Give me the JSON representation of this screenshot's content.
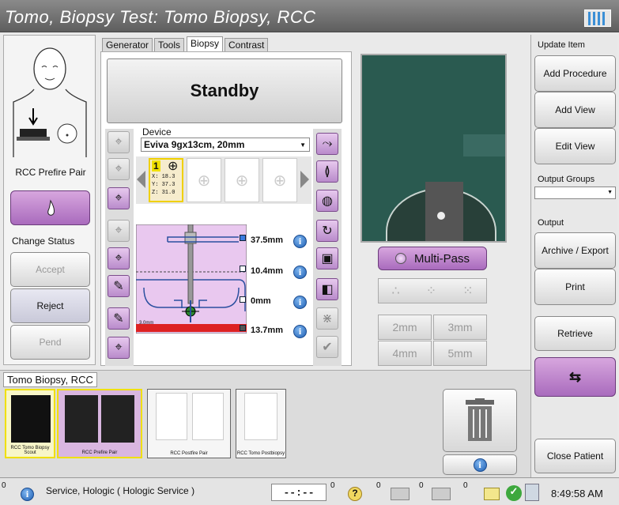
{
  "title": "Tomo, Biopsy Test:  Tomo Biopsy, RCC",
  "tabs": [
    "Generator",
    "Tools",
    "Biopsy",
    "Contrast"
  ],
  "left_panel": {
    "view_label": "RCC Prefire Pair",
    "change_status_label": "Change Status",
    "accept": "Accept",
    "reject": "Reject",
    "pend": "Pend"
  },
  "center": {
    "status": "Standby",
    "device_label": "Device",
    "device_value": "Eviva 9gx13cm, 20mm",
    "target": {
      "index": "1",
      "x": "X: 18.3",
      "y": "Y: 37.3",
      "z": "Z: 31.0"
    },
    "values": [
      "37.5mm",
      "10.4mm",
      "0mm",
      "13.7mm"
    ],
    "diagram_label": "3.0mm",
    "multipass": "Multi-Pass",
    "mm_buttons": [
      "2mm",
      "3mm",
      "4mm",
      "5mm"
    ]
  },
  "right_panel": {
    "update_item": "Update Item",
    "add_procedure": "Add Procedure",
    "add_view": "Add View",
    "edit_view": "Edit View",
    "output_groups": "Output Groups",
    "output": "Output",
    "archive_export": "Archive / Export",
    "print": "Print",
    "retrieve": "Retrieve",
    "close_patient": "Close Patient"
  },
  "procedure": {
    "name": "Tomo Biopsy, RCC",
    "thumbnails": [
      "RCC Tomo Biopsy Scout",
      "RCC Prefire Pair",
      "RCC Postfire Pair",
      "RCC Tomo Postbiopsy"
    ]
  },
  "status_bar": {
    "counter_left": "0",
    "user": "Service, Hologic ( Hologic Service )",
    "timer": "--:--",
    "counts": [
      "0",
      "0",
      "0",
      "0"
    ],
    "time": "8:49:58 AM"
  },
  "colors": {
    "accent_purple": "#b57fc7",
    "info_blue": "#2a6fc0",
    "highlight_yellow": "#f0e000",
    "bg": "#eaeaea"
  }
}
